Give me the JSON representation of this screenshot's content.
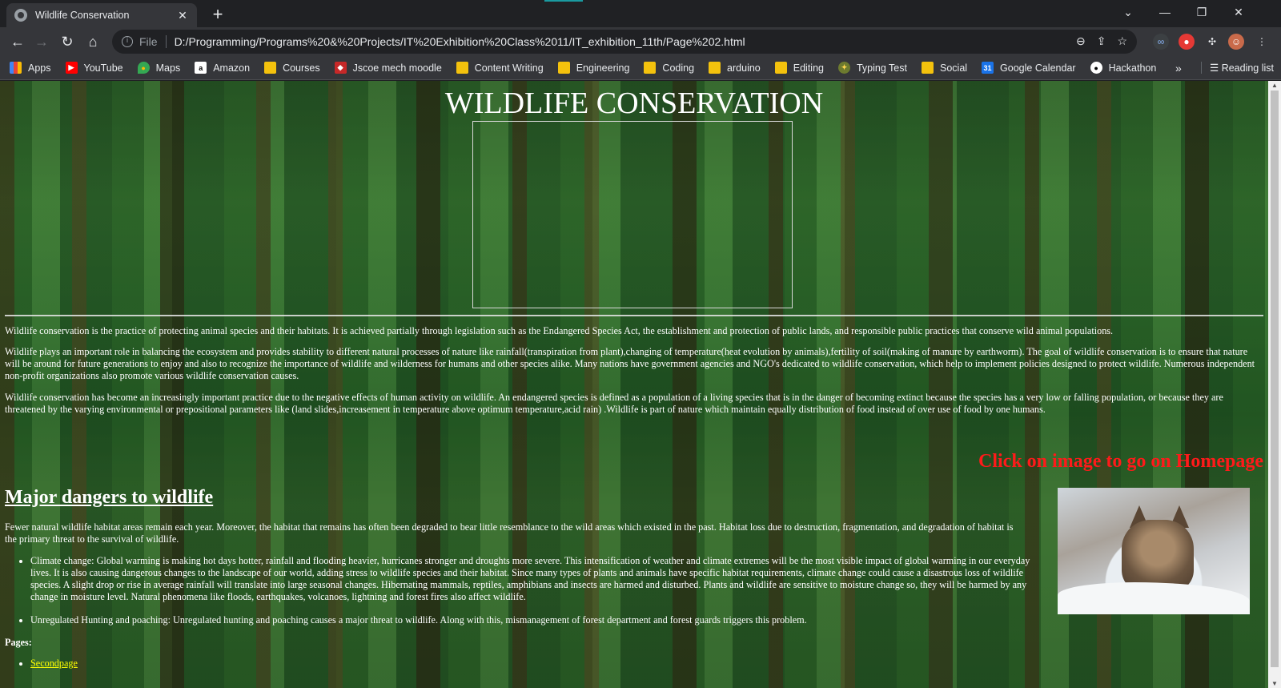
{
  "browser": {
    "tab_title": "Wildlife Conservation",
    "tab_close": "✕",
    "new_tab": "+",
    "window_controls": {
      "dropdown": "⌄",
      "minimize": "—",
      "restore": "❐",
      "close": "✕"
    },
    "nav": {
      "back": "←",
      "forward": "→",
      "reload": "↻",
      "home": "⌂"
    },
    "scheme_label": "File",
    "url": "D:/Programming/Programs%20&%20Projects/IT%20Exhibition%20Class%2011/IT_exhibition_11th/Page%202.html",
    "omnibox_icons": {
      "zoom": "⊖",
      "share": "⇪",
      "star": "☆"
    },
    "bookmarks": [
      {
        "label": "Apps",
        "icon": "apps-grid-icon"
      },
      {
        "label": "YouTube",
        "icon": "youtube-icon"
      },
      {
        "label": "Maps",
        "icon": "maps-icon"
      },
      {
        "label": "Amazon",
        "icon": "amazon-icon"
      },
      {
        "label": "Courses",
        "icon": "folder-icon"
      },
      {
        "label": "Jscoe mech moodle",
        "icon": "moodle-icon"
      },
      {
        "label": "Content Writing",
        "icon": "folder-icon"
      },
      {
        "label": "Engineering",
        "icon": "folder-icon"
      },
      {
        "label": "Coding",
        "icon": "folder-icon"
      },
      {
        "label": "arduino",
        "icon": "folder-icon"
      },
      {
        "label": "Editing",
        "icon": "folder-icon"
      },
      {
        "label": "Typing Test",
        "icon": "typing-test-icon"
      },
      {
        "label": "Social",
        "icon": "folder-icon"
      },
      {
        "label": "Google Calendar",
        "icon": "calendar-icon"
      },
      {
        "label": "Hackathon",
        "icon": "hackathon-icon"
      }
    ],
    "bookmarks_more": "»",
    "reading_list": "Reading list"
  },
  "page": {
    "title": "WILDLIFE CONSERVATION",
    "paragraphs": [
      "Wildlife conservation is the practice of protecting animal species and their habitats. It is achieved partially through legislation such as the Endangered Species Act, the establishment and protection of public lands, and responsible public practices that conserve wild animal populations.",
      "Wildlife plays an important role in balancing the ecosystem and provides stability to different natural processes of nature like rainfall(transpiration from plant),changing of temperature(heat evolution by animals),fertility of soil(making of manure by earthworm). The goal of wildlife conservation is to ensure that nature will be around for future generations to enjoy and also to recognize the importance of wildlife and wilderness for humans and other species alike. Many nations have government agencies and NGO's dedicated to wildlife conservation, which help to implement policies designed to protect wildlife. Numerous independent non-profit organizations also promote various wildlife conservation causes.",
      "Wildlife conservation has become an increasingly important practice due to the negative effects of human activity on wildlife. An endangered species is defined as a population of a living species that is in the danger of becoming extinct because the species has a very low or falling population, or because they are threatened by the varying environmental or prepositional parameters like (land slides,increasement in temperature above optimum temperature,acid rain) .Wildlife is part of nature which maintain equally distribution of food instead of over use of food by one humans."
    ],
    "home_hint": "Click on image to go on Homepage",
    "section_heading": "Major dangers to wildlife",
    "section_intro": "Fewer natural wildlife habitat areas remain each year. Moreover, the habitat that remains has often been degraded to bear little resemblance to the wild areas which existed in the past. Habitat loss due to destruction, fragmentation, and degradation of habitat is the primary threat to the survival of wildlife.",
    "dangers": [
      "Climate change: Global warming is making hot days hotter, rainfall and flooding heavier, hurricanes stronger and droughts more severe. This intensification of weather and climate extremes will be the most visible impact of global warming in our everyday lives. It is also causing dangerous changes to the landscape of our world, adding stress to wildlife species and their habitat. Since many types of plants and animals have specific habitat requirements, climate change could cause a disastrous loss of wildlife species. A slight drop or rise in average rainfall will translate into large seasonal changes. Hibernating mammals, reptiles, amphibians and insects are harmed and disturbed. Plants and wildlife are sensitive to moisture change so, they will be harmed by any change in moisture level. Natural phenomena like floods, earthquakes, volcanoes, lightning and forest fires also affect wildlife.",
      "Unregulated Hunting and poaching: Unregulated hunting and poaching causes a major threat to wildlife. Along with this, mismanagement of forest department and forest guards triggers this problem."
    ],
    "pages_label": "Pages:",
    "pages_links": [
      "Secondpage"
    ]
  },
  "colors": {
    "hint_red": "#ff1a1a",
    "link_yellow": "#ffff00",
    "chrome_dark": "#202124",
    "chrome_mid": "#35363a"
  }
}
